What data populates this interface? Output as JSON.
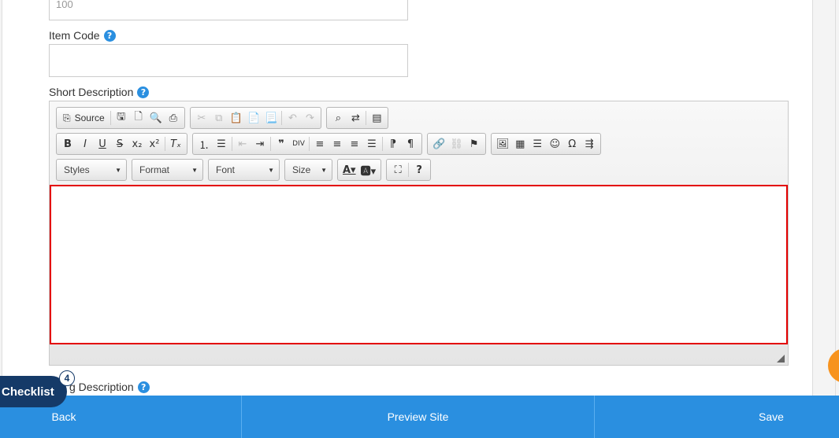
{
  "fields": {
    "top_value": "100",
    "item_code_label": "Item Code",
    "short_desc_label": "Short Description",
    "long_desc_label": "g Description"
  },
  "toolbar": {
    "source_label": "Source",
    "styles": "Styles",
    "format": "Format",
    "font": "Font",
    "size": "Size",
    "help": "?"
  },
  "checklist": {
    "label": "Checklist",
    "count": "4"
  },
  "footer": {
    "back": "Back",
    "preview": "Preview Site",
    "save": "Save"
  },
  "colors": {
    "primary": "#2a8fe0",
    "checklist": "#153a68",
    "editor_focus": "#e30000",
    "fab": "#f7931e"
  }
}
